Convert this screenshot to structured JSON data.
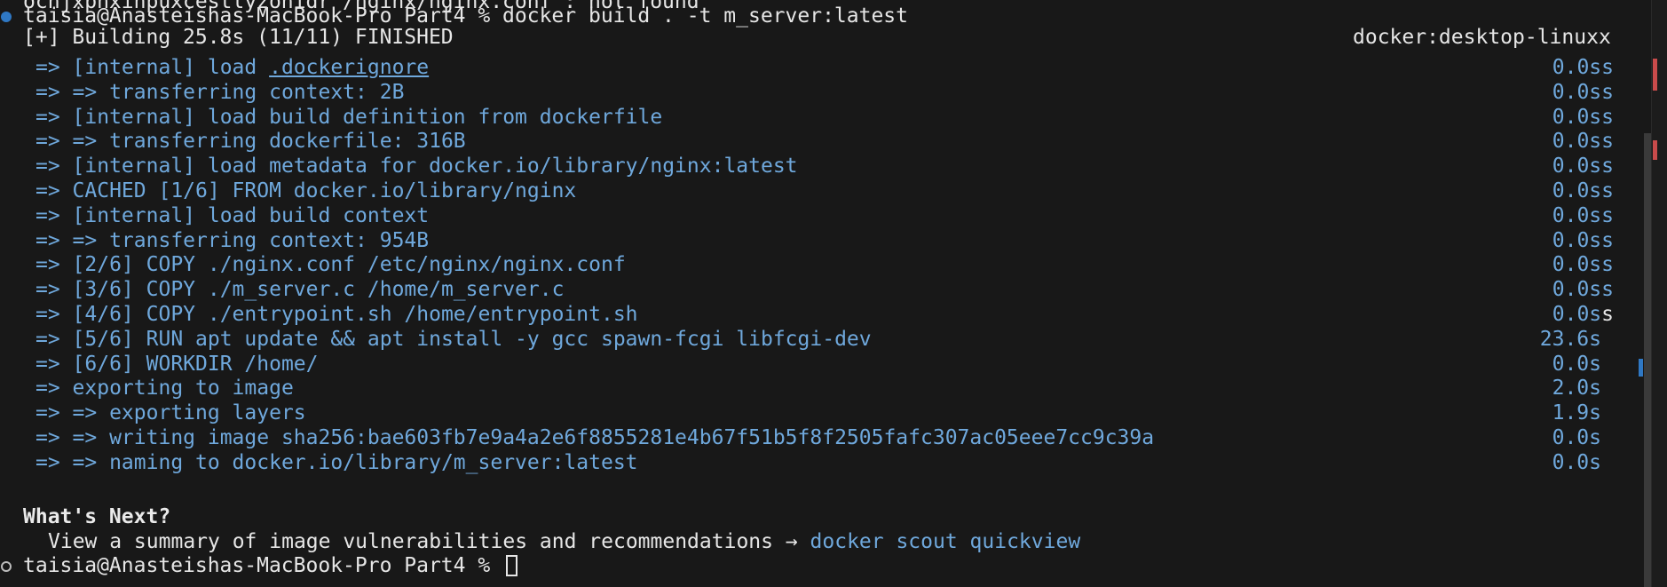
{
  "terminal": {
    "cut_top_line": "ocnjxpnxinpuxcestlyzonidr /nginx/nginx.conf : not found",
    "prompt_line": "taisia@Anasteishas-MacBook-Pro Part4 % docker build . -t m_server:latest",
    "build_header": "[+] Building 25.8s (11/11) FINISHED",
    "builder_name": "docker:desktop-linuxx",
    "steps": [
      {
        "prefix": "=> [internal] load ",
        "link": ".dockerignore",
        "suffix": "",
        "time": "0.0ss"
      },
      {
        "prefix": "=> => transferring context: 2B",
        "link": "",
        "suffix": "",
        "time": "0.0ss"
      },
      {
        "prefix": "=> [internal] load build definition from dockerfile",
        "link": "",
        "suffix": "",
        "time": "0.0ss"
      },
      {
        "prefix": "=> => transferring dockerfile: 316B",
        "link": "",
        "suffix": "",
        "time": "0.0ss"
      },
      {
        "prefix": "=> [internal] load metadata for docker.io/library/nginx:latest",
        "link": "",
        "suffix": "",
        "time": "0.0ss"
      },
      {
        "prefix": "=> CACHED [1/6] FROM docker.io/library/nginx",
        "link": "",
        "suffix": "",
        "time": "0.0ss"
      },
      {
        "prefix": "=> [internal] load build context",
        "link": "",
        "suffix": "",
        "time": "0.0ss"
      },
      {
        "prefix": "=> => transferring context: 954B",
        "link": "",
        "suffix": "",
        "time": "0.0ss"
      },
      {
        "prefix": "=> [2/6] COPY ./nginx.conf /etc/nginx/nginx.conf",
        "link": "",
        "suffix": "",
        "time": "0.0ss"
      },
      {
        "prefix": "=> [3/6] COPY ./m_server.c /home/m_server.c",
        "link": "",
        "suffix": "",
        "time": "0.0ss"
      },
      {
        "prefix": "=> [4/6] COPY ./entrypoint.sh /home/entrypoint.sh",
        "link": "",
        "suffix": "",
        "time": "0.0s",
        "extra": "s"
      },
      {
        "prefix": "=> [5/6] RUN apt update && apt install -y gcc spawn-fcgi libfcgi-dev",
        "link": "",
        "suffix": "",
        "time": "23.6s"
      },
      {
        "prefix": "=> [6/6] WORKDIR /home/",
        "link": "",
        "suffix": "",
        "time": "0.0s"
      },
      {
        "prefix": "=> exporting to image",
        "link": "",
        "suffix": "",
        "time": "2.0s"
      },
      {
        "prefix": "=> => exporting layers",
        "link": "",
        "suffix": "",
        "time": "1.9s"
      },
      {
        "prefix": "=> => writing image sha256:bae603fb7e9a4a2e6f8855281e4b67f51b5f8f2505fafc307ac05eee7cc9c39a",
        "link": "",
        "suffix": "",
        "time": "0.0s"
      },
      {
        "prefix": "=> => naming to docker.io/library/m_server:latest",
        "link": "",
        "suffix": "",
        "time": "0.0s"
      }
    ],
    "whats_next_title": "What's Next?",
    "summary_text": "View a summary of image vulnerabilities and recommendations → ",
    "summary_link": "docker scout quickview",
    "final_prompt": "taisia@Anasteishas-MacBook-Pro Part4 % "
  },
  "colors": {
    "background": "#181818",
    "step_blue": "#6fa8dc",
    "text": "#e6e6e6",
    "prompt_dot_active": "#2f78c4",
    "scroll_marker_red": "#c94b4b"
  }
}
